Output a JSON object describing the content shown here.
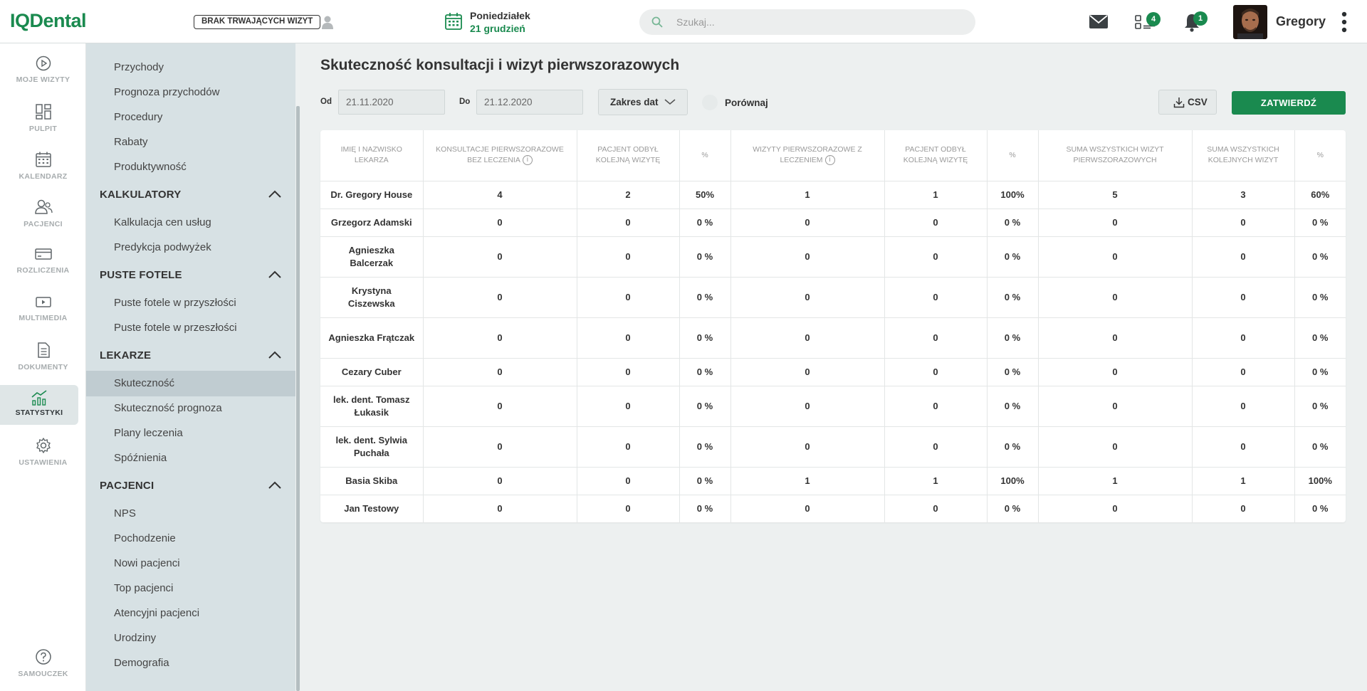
{
  "app": {
    "logo": "IQDental"
  },
  "topbar": {
    "no_visit_label": "BRAK TRWAJĄCYCH WIZYT",
    "day_name": "Poniedziałek",
    "date": "21 grudzień",
    "search_placeholder": "Szukaj...",
    "tasks_badge": "4",
    "notifications_badge": "1",
    "user_name": "Gregory"
  },
  "rail": {
    "items": [
      {
        "label": "MOJE WIZYTY",
        "icon": "play-circle-icon"
      },
      {
        "label": "PULPIT",
        "icon": "dashboard-icon"
      },
      {
        "label": "KALENDARZ",
        "icon": "calendar-icon"
      },
      {
        "label": "PACJENCI",
        "icon": "patients-icon"
      },
      {
        "label": "ROZLICZENIA",
        "icon": "credit-card-icon"
      },
      {
        "label": "MULTIMEDIA",
        "icon": "media-icon"
      },
      {
        "label": "DOKUMENTY",
        "icon": "document-icon"
      },
      {
        "label": "STATYSTYKI",
        "icon": "chart-icon",
        "active": true
      },
      {
        "label": "USTAWIENIA",
        "icon": "gear-icon"
      }
    ],
    "help_label": "SAMOUCZEK"
  },
  "submenu": {
    "top_items": [
      "Przychody",
      "Prognoza przychodów",
      "Procedury",
      "Rabaty",
      "Produktywność"
    ],
    "sections": [
      {
        "title": "KALKULATORY",
        "items": [
          "Kalkulacja cen usług",
          "Predykcja podwyżek"
        ]
      },
      {
        "title": "PUSTE FOTELE",
        "items": [
          "Puste fotele w przyszłości",
          "Puste fotele w przeszłości"
        ]
      },
      {
        "title": "LEKARZE",
        "items": [
          "Skuteczność",
          "Skuteczność prognoza",
          "Plany leczenia",
          "Spóźnienia"
        ]
      },
      {
        "title": "PACJENCI",
        "items": [
          "NPS",
          "Pochodzenie",
          "Nowi pacjenci",
          "Top pacjenci",
          "Atencyjni pacjenci",
          "Urodziny",
          "Demografia"
        ]
      }
    ]
  },
  "main": {
    "title": "Skuteczność konsultacji i wizyt pierwszorazowych",
    "from_label": "Od",
    "from_value": "21.11.2020",
    "to_label": "Do",
    "to_value": "21.12.2020",
    "range_label": "Zakres dat",
    "compare_label": "Porównaj",
    "csv_label": "CSV",
    "confirm_label": "ZATWIERDŹ"
  },
  "table": {
    "headers": [
      "IMIĘ I NAZWISKO LEKARZA",
      "KONSULTACJE PIERWSZORAZOWE BEZ LECZENIA",
      "PACJENT ODBYŁ KOLEJNĄ WIZYTĘ",
      "%",
      "WIZYTY PIERWSZORAZOWE Z LECZENIEM",
      "PACJENT ODBYŁ KOLEJNĄ WIZYTĘ",
      "%",
      "SUMA WSZYSTKICH WIZYT PIERWSZORAZOWYCH",
      "SUMA WSZYSTKICH KOLEJNYCH WIZYT",
      "%"
    ],
    "rows": [
      [
        "Dr. Gregory House",
        "4",
        "2",
        "50%",
        "1",
        "1",
        "100%",
        "5",
        "3",
        "60%"
      ],
      [
        "Grzegorz Adamski",
        "0",
        "0",
        "0 %",
        "0",
        "0",
        "0 %",
        "0",
        "0",
        "0 %"
      ],
      [
        "Agnieszka Balcerzak",
        "0",
        "0",
        "0 %",
        "0",
        "0",
        "0 %",
        "0",
        "0",
        "0 %"
      ],
      [
        "Krystyna Ciszewska",
        "0",
        "0",
        "0 %",
        "0",
        "0",
        "0 %",
        "0",
        "0",
        "0 %"
      ],
      [
        "Agnieszka Frątczak",
        "0",
        "0",
        "0 %",
        "0",
        "0",
        "0 %",
        "0",
        "0",
        "0 %"
      ],
      [
        "Cezary Cuber",
        "0",
        "0",
        "0 %",
        "0",
        "0",
        "0 %",
        "0",
        "0",
        "0 %"
      ],
      [
        "lek. dent. Tomasz Łukasik",
        "0",
        "0",
        "0 %",
        "0",
        "0",
        "0 %",
        "0",
        "0",
        "0 %"
      ],
      [
        "lek. dent. Sylwia Puchała",
        "0",
        "0",
        "0 %",
        "0",
        "0",
        "0 %",
        "0",
        "0",
        "0 %"
      ],
      [
        "Basia Skiba",
        "0",
        "0",
        "0 %",
        "1",
        "1",
        "100%",
        "1",
        "1",
        "100%"
      ],
      [
        "Jan Testowy",
        "0",
        "0",
        "0 %",
        "0",
        "0",
        "0 %",
        "0",
        "0",
        "0 %"
      ]
    ]
  },
  "colors": {
    "brand": "#1a8a4f",
    "submenu_bg": "#d7e1e4",
    "page_bg": "#edf0f0"
  }
}
